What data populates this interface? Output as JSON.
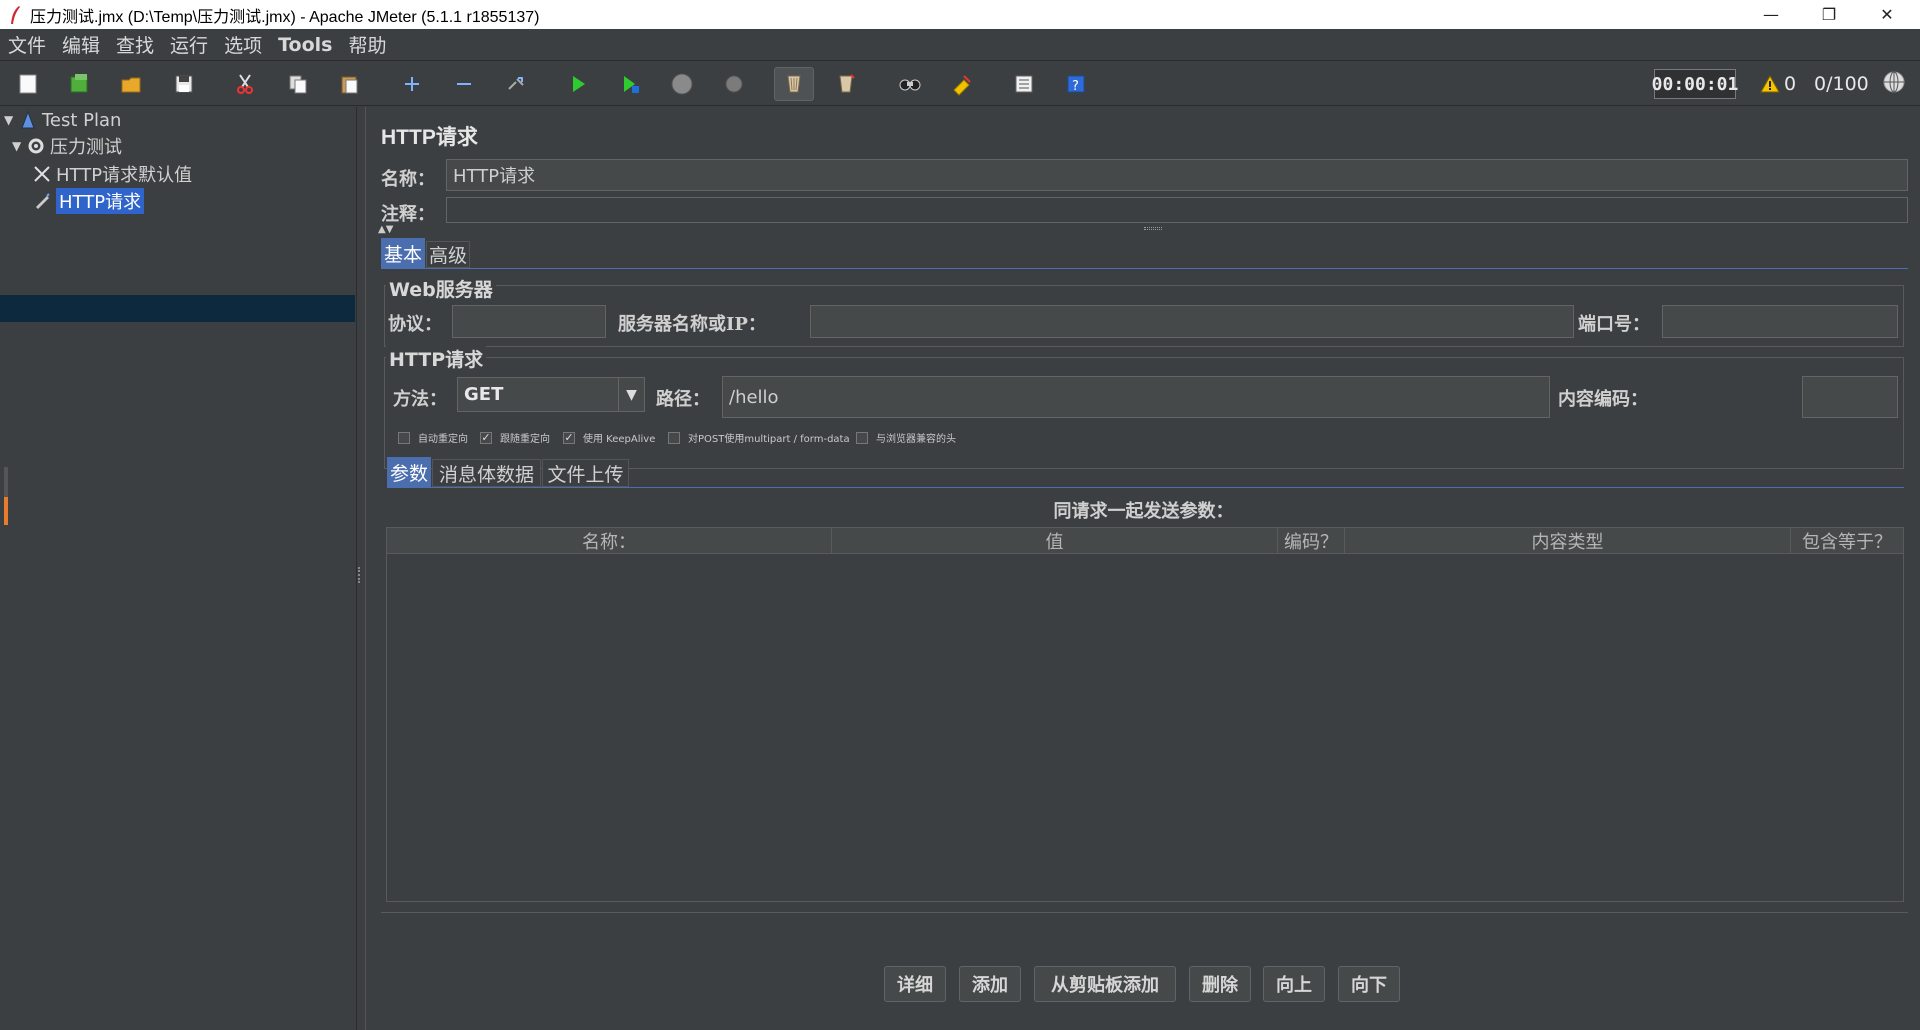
{
  "window": {
    "title": "压力测试.jmx (D:\\Temp\\压力测试.jmx) - Apache JMeter (5.1.1 r1855137)",
    "minimize": "—",
    "maximize": "❐",
    "close": "✕"
  },
  "menu": [
    "文件",
    "编辑",
    "查找",
    "运行",
    "选项",
    "Tools",
    "帮助"
  ],
  "toolbar": {
    "buttons": [
      "new-icon",
      "templates-icon",
      "open-icon",
      "save-icon",
      "cut-icon",
      "copy-icon",
      "paste-icon",
      "expand-icon",
      "collapse-icon",
      "toggle-icon",
      "start-icon",
      "start-no-pause-icon",
      "stop-icon",
      "shutdown-icon",
      "clear-icon",
      "clear-all-icon",
      "search-icon",
      "reset-search-icon",
      "function-helper-icon",
      "help-icon"
    ],
    "timer": "00:00:01",
    "warnings": "0",
    "threads": "0/100"
  },
  "tree": {
    "items": [
      {
        "label": "Test Plan",
        "icon": "test-plan-icon"
      },
      {
        "label": "压力测试",
        "icon": "thread-group-icon"
      },
      {
        "label": "HTTP请求默认值",
        "icon": "config-icon"
      },
      {
        "label": "HTTP请求",
        "icon": "sampler-icon"
      }
    ]
  },
  "panel": {
    "title": "HTTP请求",
    "name_label": "名称：",
    "name_value": "HTTP请求",
    "comment_label": "注释：",
    "comment_value": "",
    "tabs": [
      "基本",
      "高级"
    ],
    "web_server": {
      "title": "Web服务器",
      "protocol_label": "协议：",
      "protocol_value": "",
      "server_label": "服务器名称或IP：",
      "server_value": "",
      "port_label": "端口号：",
      "port_value": ""
    },
    "http_request": {
      "title": "HTTP请求",
      "method_label": "方法：",
      "method_value": "GET",
      "path_label": "路径：",
      "path_value": "/hello",
      "encoding_label": "内容编码：",
      "encoding_value": ""
    },
    "checkboxes": [
      {
        "label": "自动重定向",
        "checked": false
      },
      {
        "label": "跟随重定向",
        "checked": true
      },
      {
        "label": "使用 KeepAlive",
        "checked": true
      },
      {
        "label": "对POST使用multipart / form-data",
        "checked": false
      },
      {
        "label": "与浏览器兼容的头",
        "checked": false
      }
    ],
    "sub_tabs": [
      "参数",
      "消息体数据",
      "文件上传"
    ],
    "params_caption": "同请求一起发送参数：",
    "columns": [
      "名称：",
      "值",
      "编码？",
      "内容类型",
      "包含等于？"
    ],
    "buttons": [
      "详细",
      "添加",
      "从剪贴板添加",
      "删除",
      "向上",
      "向下"
    ]
  },
  "colors": {
    "background": "#3c3f41",
    "selection": "#2f65ca",
    "active_tab": "#4b6eaf"
  }
}
